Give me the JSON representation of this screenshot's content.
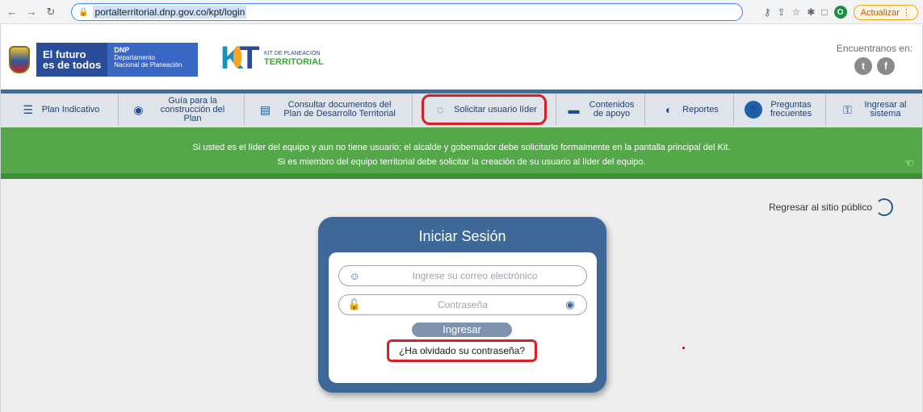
{
  "browser": {
    "url": "portalterritorial.dnp.gov.co/kpt/login",
    "profile_initial": "O",
    "update_label": "Actualizar"
  },
  "header": {
    "futuro_line1": "El futuro",
    "futuro_line2": "es de todos",
    "dnp_short": "DNP",
    "dnp_line1": "Departamento",
    "dnp_line2": "Nacional de Planeación",
    "kit_small": "KIT DE PLANEACIÓN",
    "kit_big": "TERRITORIAL",
    "social_label": "Encuentranos en:"
  },
  "nav": {
    "items": [
      {
        "label": "Plan Indicativo",
        "icon": "list-check-icon"
      },
      {
        "label": "Guía para la construcción del Plan",
        "icon": "eye-hand-icon"
      },
      {
        "label": "Consultar documentos del Plan de Desarrollo Territorial",
        "icon": "document-icon"
      },
      {
        "label": "Solicitar usuario líder",
        "icon": "user-icon"
      },
      {
        "label": "Contenidos de apoyo",
        "icon": "support-content-icon"
      },
      {
        "label": "Reportes",
        "icon": "reports-icon"
      },
      {
        "label": "Preguntas frecuentes",
        "icon": "question-icon"
      },
      {
        "label": "Ingresar al sistema",
        "icon": "key-icon"
      }
    ]
  },
  "banner": {
    "line1": "Si usted es el líder del equipo y aun no tiene usuario; el alcalde y gobernador debe solicitarlo formalmente en la pantalla principal del Kit.",
    "line2": "Si es miembro del equipo territorial debe solicitar la creación de su usuario al líder del equipo."
  },
  "back_link": "Regresar al sitio público",
  "login": {
    "title": "Iniciar Sesión",
    "email_placeholder": "Ingrese su correo electrónico",
    "password_placeholder": "Contraseña",
    "submit_label": "Ingresar",
    "forgot_label": "¿Ha olvidado su contraseña?"
  },
  "colors": {
    "nav_accent": "#3e6f9a",
    "banner_green": "#54a84a",
    "card_blue": "#3d6898",
    "highlight_red": "#d61f26"
  }
}
